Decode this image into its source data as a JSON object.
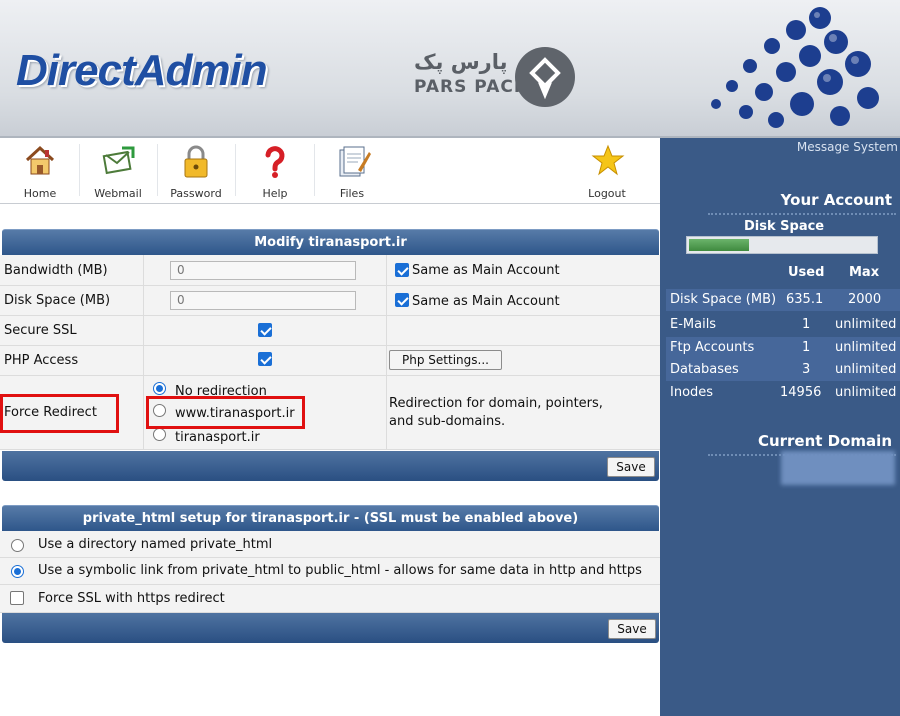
{
  "header": {
    "logo_text": "DirectAdmin",
    "partner_logo_fa": "پارس پک",
    "partner_logo_en": "PARS PACK"
  },
  "toolbar": {
    "items": [
      {
        "label": "Home",
        "icon": "home-icon"
      },
      {
        "label": "Webmail",
        "icon": "webmail-icon"
      },
      {
        "label": "Password",
        "icon": "password-lock-icon"
      },
      {
        "label": "Help",
        "icon": "help-question-icon"
      },
      {
        "label": "Files",
        "icon": "files-icon"
      },
      {
        "label": "Logout",
        "icon": "logout-star-icon"
      }
    ]
  },
  "modify": {
    "title": "Modify tiranasport.ir",
    "bandwidth_label": "Bandwidth (MB)",
    "bandwidth_value": "0",
    "bandwidth_same": "Same as Main Account",
    "disk_label": "Disk Space (MB)",
    "disk_value": "0",
    "disk_same": "Same as Main Account",
    "ssl_label": "Secure SSL",
    "php_label": "PHP Access",
    "php_settings_button": "Php Settings...",
    "redirect_label": "Force Redirect",
    "redirect_options": [
      "No redirection",
      "www.tiranasport.ir",
      "tiranasport.ir"
    ],
    "redirect_desc_1": "Redirection for domain, pointers,",
    "redirect_desc_2": "and sub-domains.",
    "save_button": "Save"
  },
  "private_html": {
    "title": "private_html setup for tiranasport.ir - (SSL must be enabled above)",
    "option_dir": "Use a directory named private_html",
    "option_symlink": "Use a symbolic link from private_html to public_html - allows for same data in http and https",
    "force_ssl": "Force SSL with https redirect",
    "save_button": "Save"
  },
  "sidebar": {
    "message_system": "Message System",
    "your_account": "Your Account",
    "disk_space_label": "Disk Space",
    "disk_usage_fraction": 0.32,
    "col_used": "Used",
    "col_max": "Max",
    "stats": [
      {
        "label": "Disk Space (MB)",
        "used": "635.1",
        "max": "2000"
      },
      {
        "label": "E-Mails",
        "used": "1",
        "max": "unlimited"
      },
      {
        "label": "Ftp Accounts",
        "used": "1",
        "max": "unlimited"
      },
      {
        "label": "Databases",
        "used": "3",
        "max": "unlimited"
      },
      {
        "label": "Inodes",
        "used": "14956",
        "max": "unlimited"
      }
    ],
    "current_domain": "Current Domain"
  },
  "colors": {
    "brand_blue": "#1f4fa3",
    "panel_blue": "#3a5a87",
    "highlight_red": "#e01010",
    "checkbox_blue": "#1a6fd6"
  }
}
